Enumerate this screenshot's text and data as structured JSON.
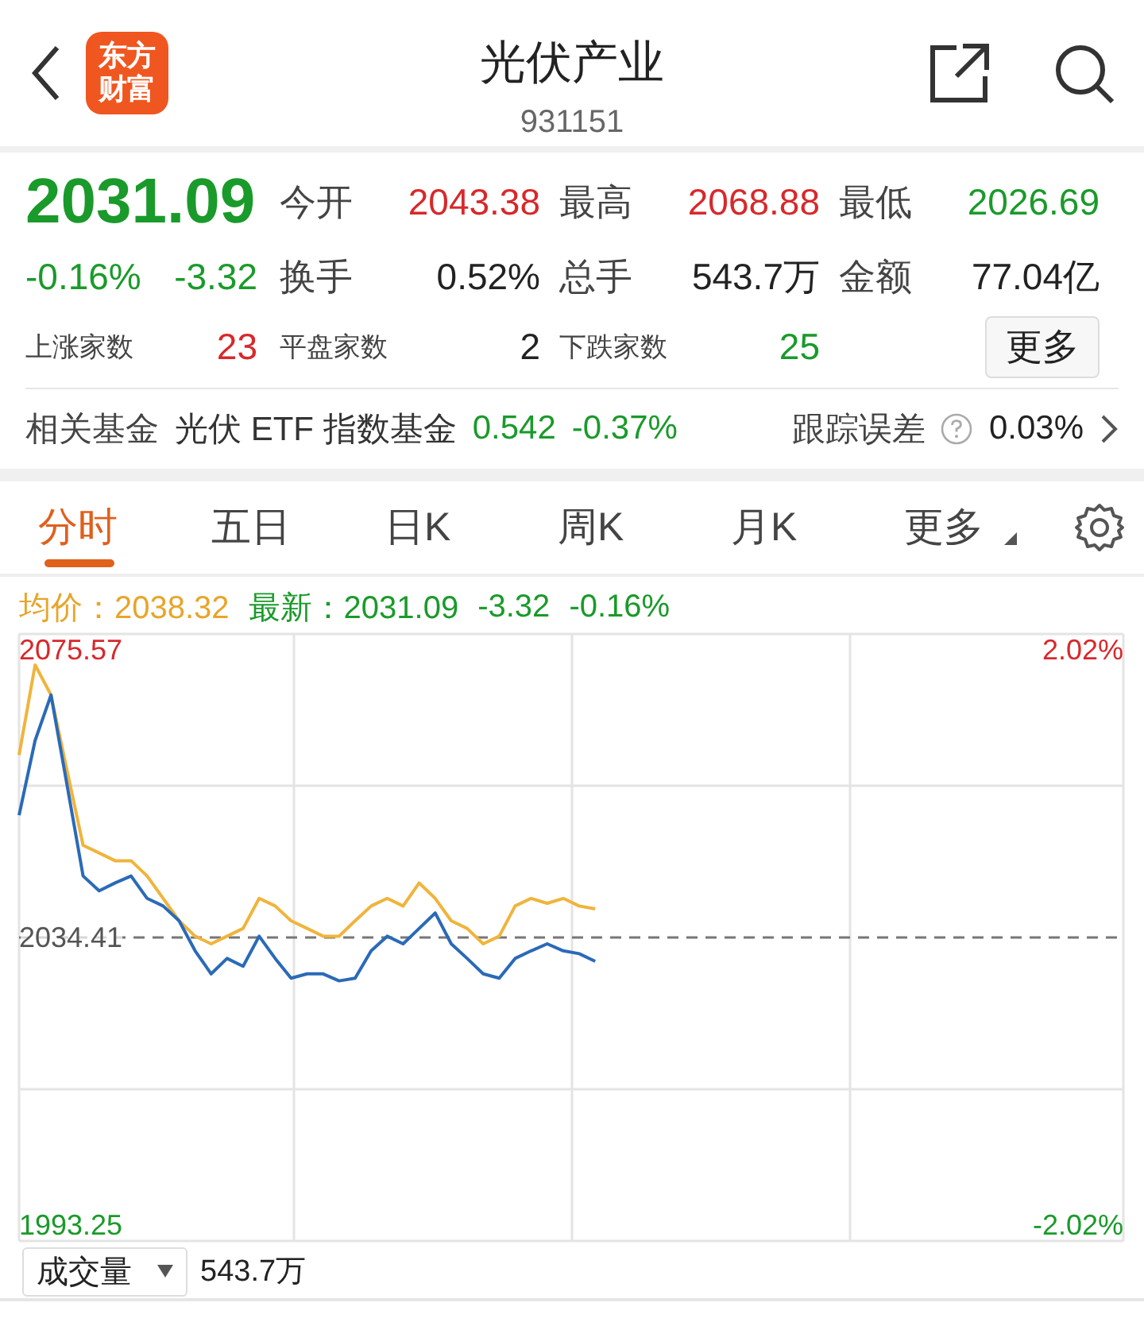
{
  "header": {
    "logo": "东方财富",
    "title": "光伏产业",
    "code": "931151"
  },
  "quote": {
    "price": "2031.09",
    "change_pct": "-0.16%",
    "change": "-3.32",
    "color": "#1a9a2a"
  },
  "stats": [
    {
      "label": "今开",
      "value": "2043.38",
      "color": "#d8282b"
    },
    {
      "label": "最高",
      "value": "2068.88",
      "color": "#d8282b"
    },
    {
      "label": "最低",
      "value": "2026.69",
      "color": "#1a9a2a"
    },
    {
      "label": "换手",
      "value": "0.52%",
      "color": "#222222"
    },
    {
      "label": "总手",
      "value": "543.7万",
      "color": "#222222"
    },
    {
      "label": "金额",
      "value": "77.04亿",
      "color": "#222222"
    }
  ],
  "breadth": [
    {
      "label": "上涨家数",
      "value": "23",
      "color": "#d8282b"
    },
    {
      "label": "平盘家数",
      "value": "2",
      "color": "#222222"
    },
    {
      "label": "下跌家数",
      "value": "25",
      "color": "#1a9a2a"
    }
  ],
  "more_button": "更多",
  "fund": {
    "label": "相关基金",
    "name": "光伏 ETF 指数基金",
    "price": "0.542",
    "change": "-0.37%",
    "color": "#1a9a2a",
    "error_label": "跟踪误差",
    "error": "0.03%"
  },
  "tabs": [
    {
      "label": "分时",
      "selected": true,
      "kind": "plain"
    },
    {
      "label": "五日",
      "selected": false,
      "kind": "plain"
    },
    {
      "label": "日K",
      "selected": false,
      "kind": "plain"
    },
    {
      "label": "周K",
      "selected": false,
      "kind": "plain"
    },
    {
      "label": "月K",
      "selected": false,
      "kind": "plain"
    },
    {
      "label": "更多",
      "selected": false,
      "kind": "dropdown"
    }
  ],
  "legend": {
    "avg": "2038.32",
    "latest": "2031.09",
    "change": "-3.32",
    "change_pct": "-0.16%"
  },
  "chart": {
    "right_labels": [
      "2.02%",
      "-2.02%"
    ],
    "chart_data": {
      "type": "line",
      "categories": [
        null,
        null,
        null,
        null,
        null,
        null,
        null,
        null,
        null,
        null,
        null,
        null,
        null,
        null,
        null,
        null,
        null,
        null,
        null,
        null,
        null,
        null,
        null,
        null,
        null,
        null,
        null,
        null,
        null,
        null,
        null,
        null,
        null,
        null,
        null,
        null,
        null,
        null,
        null,
        null,
        null,
        null,
        null,
        null,
        null,
        null,
        null,
        null,
        null,
        null,
        null,
        null,
        null,
        null,
        null,
        null,
        null,
        null,
        null,
        null,
        null,
        null,
        null,
        null,
        null,
        null,
        null,
        null,
        null,
        null
      ],
      "ylim": [
        1990.99,
        2077.83
      ],
      "ref_lines": [
        {
          "axis": "y",
          "value": 2034.41
        }
      ],
      "yticks": [
        {
          "value": 1993.25,
          "label": "1993.25"
        },
        {
          "value": 2034.41,
          "label": "2034.41"
        },
        {
          "value": 2075.57,
          "label": "2075.57"
        }
      ],
      "series": [
        {
          "name": "均价：",
          "color": "#f0b43c",
          "values": [
            2060.5,
            2073.4,
            2069.1,
            2058.3,
            2047.6,
            2046.5,
            2045.4,
            2045.4,
            2043.2,
            2040,
            2036.8,
            2034.6,
            2033.5,
            2034.6,
            2035.7,
            2040,
            2038.9,
            2036.8,
            2035.7,
            2034.6,
            2034.6,
            2036.8,
            2038.9,
            2040,
            2038.9,
            2042.2,
            2040,
            2036.8,
            2035.7,
            2033.5,
            2034.6,
            2038.9,
            2040,
            2039.3,
            2040,
            2038.9,
            2038.5,
            null,
            null,
            null,
            null,
            null,
            null,
            null,
            null,
            null,
            null,
            null,
            null,
            null,
            null,
            null,
            null,
            null,
            null,
            null,
            null,
            null,
            null,
            null,
            null,
            null,
            null,
            null,
            null,
            null,
            null,
            null,
            null,
            null
          ]
        },
        {
          "name": "最新：",
          "color": "#2a6ab8",
          "values": [
            2051.9,
            2062.6,
            2069.1,
            2056.2,
            2043.2,
            2041.1,
            2042.2,
            2043.2,
            2040,
            2038.9,
            2036.8,
            2032.5,
            2029.2,
            2031.4,
            2030.3,
            2034.6,
            2031.4,
            2028.6,
            2029.2,
            2029.2,
            2028.2,
            2028.6,
            2032.5,
            2034.6,
            2033.5,
            2035.7,
            2037.9,
            2033.5,
            2031.4,
            2029.2,
            2028.6,
            2031.4,
            2032.5,
            2033.5,
            2032.5,
            2032.1,
            2031,
            null,
            null,
            null,
            null,
            null,
            null,
            null,
            null,
            null,
            null,
            null,
            null,
            null,
            null,
            null,
            null,
            null,
            null,
            null,
            null,
            null,
            null,
            null,
            null,
            null,
            null,
            null,
            null,
            null,
            null,
            null,
            null,
            null
          ]
        }
      ]
    }
  },
  "volume": {
    "selector": "成交量",
    "value": "543.7万"
  }
}
